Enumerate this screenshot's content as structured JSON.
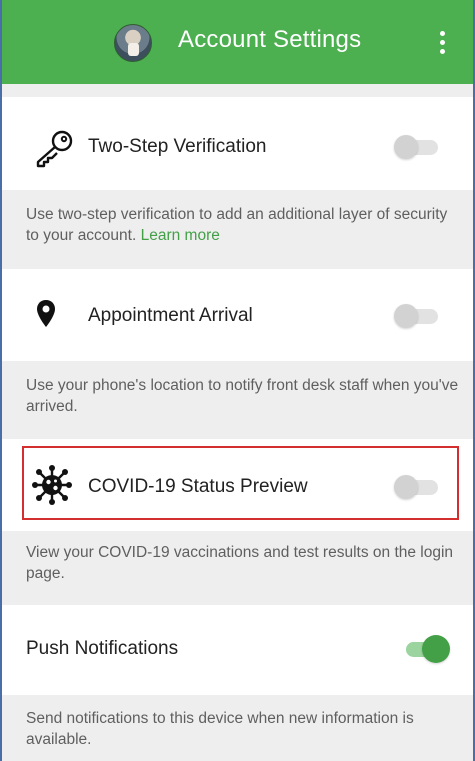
{
  "header": {
    "title": "Account Settings"
  },
  "settings": {
    "two_step": {
      "label": "Two-Step Verification",
      "desc": "Use two-step verification to add an additional layer of security to your account.",
      "link": "Learn more",
      "enabled": false
    },
    "appointment": {
      "label": "Appointment Arrival",
      "desc": "Use your phone's location to notify front desk staff when you've arrived.",
      "enabled": false
    },
    "covid": {
      "label": "COVID-19 Status Preview",
      "desc": "View your COVID-19 vaccinations and test results on the login page.",
      "enabled": false
    },
    "push": {
      "label": "Push Notifications",
      "desc": "Send notifications to this device when new information is available.",
      "enabled": true
    }
  },
  "colors": {
    "brand_green": "#4caf50",
    "link_green": "#43a047",
    "highlight_red": "#d32f2f"
  },
  "icons": {
    "two_step": "key-icon",
    "appointment": "location-pin-icon",
    "covid": "virus-icon",
    "header_menu": "more-vert-icon"
  }
}
